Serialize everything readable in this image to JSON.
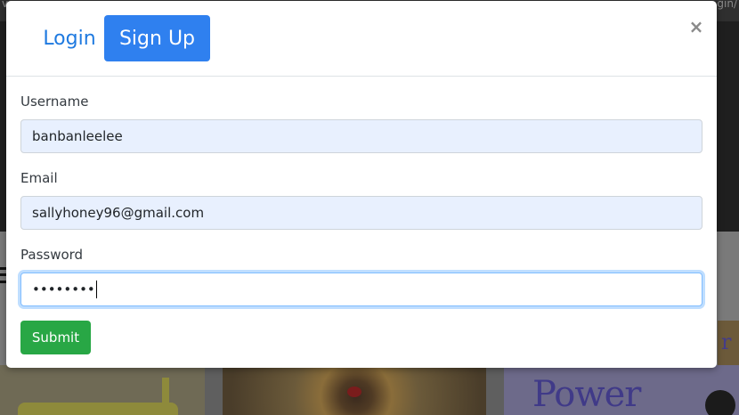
{
  "background": {
    "top_left_text": "ve",
    "top_right_text": "gin/",
    "thumbnail_text": "Power",
    "right_edge_text": "r"
  },
  "modal": {
    "tabs": [
      {
        "label": "Login",
        "active": false
      },
      {
        "label": "Sign Up",
        "active": true
      }
    ],
    "close_label": "×",
    "fields": {
      "username": {
        "label": "Username",
        "value": "banbanleelee"
      },
      "email": {
        "label": "Email",
        "value": "sallyhoney96@gmail.com"
      },
      "password": {
        "label": "Password",
        "value": "••••••••"
      }
    },
    "submit_label": "Submit"
  },
  "colors": {
    "primary": "#2f80ef",
    "success": "#28a745",
    "autofill": "#e8f0fe"
  }
}
